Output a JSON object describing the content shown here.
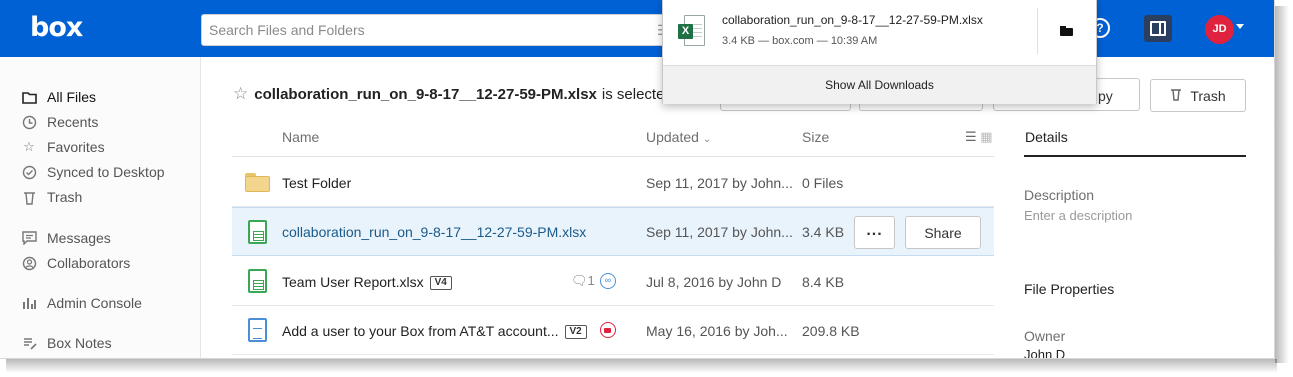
{
  "header": {
    "logo": "box",
    "search_placeholder": "Search Files and Folders",
    "avatar_initials": "JD"
  },
  "sidebar": {
    "items": [
      {
        "label": "All Files",
        "icon": "folder-icon"
      },
      {
        "label": "Recents",
        "icon": "clock-icon"
      },
      {
        "label": "Favorites",
        "icon": "star-icon"
      },
      {
        "label": "Synced to Desktop",
        "icon": "check-circle-icon"
      },
      {
        "label": "Trash",
        "icon": "trash-icon"
      },
      {
        "label": "Messages",
        "icon": "message-icon"
      },
      {
        "label": "Collaborators",
        "icon": "person-icon"
      },
      {
        "label": "Admin Console",
        "icon": "bar-chart-icon"
      },
      {
        "label": "Box Notes",
        "icon": "note-icon"
      }
    ]
  },
  "selection": {
    "filename": "collaboration_run_on_9-8-17__12-27-59-PM.xlsx",
    "suffix": "is selected",
    "copy_label": "py",
    "trash_label": "Trash"
  },
  "table": {
    "columns": {
      "name": "Name",
      "updated": "Updated",
      "size": "Size"
    },
    "rows": [
      {
        "name": "Test Folder",
        "updated": "Sep 11, 2017 by John...",
        "size": "0 Files",
        "type": "folder"
      },
      {
        "name": "collaboration_run_on_9-8-17__12-27-59-PM.xlsx",
        "updated": "Sep 11, 2017 by John...",
        "size": "3.4 KB",
        "type": "spreadsheet",
        "more_label": "...",
        "share_label": "Share"
      },
      {
        "name": "Team User Report.xlsx",
        "version": "V4",
        "comments": "1",
        "updated": "Jul 8, 2016 by John D",
        "size": "8.4 KB",
        "type": "spreadsheet"
      },
      {
        "name": "Add a user to your Box from AT&T account...",
        "version": "V2",
        "updated": "May 16, 2016 by Joh...",
        "size": "209.8 KB",
        "type": "document"
      }
    ]
  },
  "details": {
    "title": "Details",
    "description_label": "Description",
    "description_placeholder": "Enter a description",
    "file_properties_label": "File Properties",
    "owner_label": "Owner",
    "owner_value": "John D"
  },
  "downloads": {
    "filename": "collaboration_run_on_9-8-17__12-27-59-PM.xlsx",
    "meta": "3.4 KB — box.com — 10:39 AM",
    "show_all": "Show All Downloads"
  },
  "colors": {
    "brand_blue": "#0061d5",
    "avatar_red": "#e0223e",
    "selected_row": "#e9f3fb",
    "excel_green": "#1e7145"
  }
}
